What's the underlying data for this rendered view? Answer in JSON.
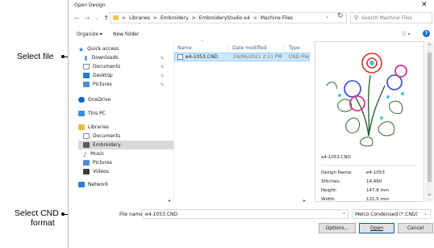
{
  "callouts": {
    "select_file": "Select file",
    "select_format_line1": "Select CND",
    "select_format_line2": "format"
  },
  "dialog": {
    "title": "Open Design",
    "close_glyph": "✕",
    "nav": {
      "back": "←",
      "forward": "→",
      "down": "⌄",
      "up": "↑"
    },
    "breadcrumb": [
      "Libraries",
      "Embroidery",
      "EmbroideryStudio e4",
      "Machine Files"
    ],
    "breadcrumb_sep": ">",
    "refresh_glyph": "↻",
    "search_placeholder": "Search Machine Files",
    "toolbar": {
      "organize": "Organize ▾",
      "new_folder": "New folder",
      "view_glyph": "☷ ▾",
      "help_glyph": "?"
    },
    "sidebar": {
      "quick_access": "Quick access",
      "downloads": "Downloads",
      "documents": "Documents",
      "desktop": "Desktop",
      "pictures": "Pictures",
      "onedrive": "OneDrive",
      "this_pc": "This PC",
      "libraries": "Libraries",
      "lib_documents": "Documents",
      "lib_embroidery": "Embroidery",
      "lib_music": "Music",
      "lib_pictures": "Pictures",
      "lib_videos": "Videos",
      "network": "Network"
    },
    "columns": {
      "name": "Name",
      "date": "Date modified",
      "type": "Type"
    },
    "files": [
      {
        "name": "e4-1053.CND",
        "date": "24/06/2021 2:11 PM",
        "type": "CND File"
      }
    ],
    "preview": {
      "filename": "e4-1053.CND",
      "props": [
        {
          "label": "Design Name:",
          "value": "e4-1053"
        },
        {
          "label": "Stitches:",
          "value": "14,460"
        },
        {
          "label": "Height:",
          "value": "147.8 mm"
        },
        {
          "label": "Width:",
          "value": "121.5 mm"
        }
      ]
    },
    "footer": {
      "filename_label": "File name:",
      "filename_value": "e4-1053.CND",
      "filetype_value": "Melco Condensed (*.CND)",
      "options": "Options...",
      "open": "Open",
      "cancel": "Cancel"
    },
    "colors": {
      "selection": "#cce8ff",
      "accent": "#0063b1"
    }
  }
}
